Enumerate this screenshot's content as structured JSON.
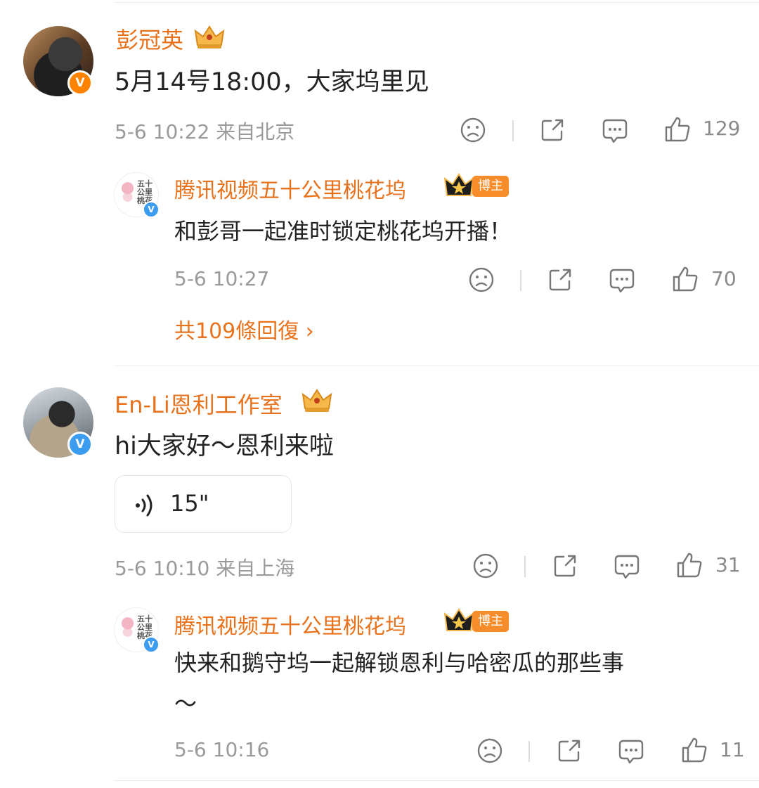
{
  "comments": [
    {
      "author": "彭冠英",
      "text": "5月14号18:00，大家坞里见",
      "time": "5-6 10:22 来自北京",
      "likes": "129",
      "reply": {
        "author": "腾讯视频五十公里桃花坞",
        "badge": "博主",
        "text": "和彭哥一起准时锁定桃花坞开播！",
        "time": "5-6 10:27",
        "likes": "70"
      },
      "more_replies": "共109條回復 ›"
    },
    {
      "author": "En-Li恩利工作室",
      "text": "hi大家好～恩利来啦",
      "voice_duration": "15\"",
      "time": "5-6 10:10 来自上海",
      "likes": "31",
      "reply": {
        "author": "腾讯视频五十公里桃花坞",
        "badge": "博主",
        "text_line1": "快来和鹅守坞一起解锁恩利与哈密瓜的那些事",
        "text_line2": "～",
        "time": "5-6 10:16",
        "likes": "11"
      }
    }
  ],
  "avatar_small_text": "五十公里桃花坞",
  "verified_mark": "V",
  "colors": {
    "accent": "#e8721c",
    "meta": "#9a9a9a",
    "verified_blue": "#3b9cf0",
    "verified_orange": "#ff8200"
  }
}
